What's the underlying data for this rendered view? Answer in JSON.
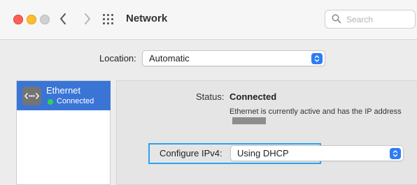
{
  "window": {
    "title": "Network"
  },
  "search": {
    "placeholder": "Search"
  },
  "location": {
    "label": "Location:",
    "value": "Automatic"
  },
  "sidebar": {
    "items": [
      {
        "name": "Ethernet",
        "status": "Connected",
        "status_color": "#2fd15a"
      }
    ]
  },
  "detail": {
    "status_label": "Status:",
    "status_value": "Connected",
    "description": "Ethernet is currently active and has the IP address",
    "configure_label": "Configure IPv4:",
    "configure_value": "Using DHCP"
  },
  "colors": {
    "accent": "#2d7cf6",
    "selection": "#3a75d6",
    "highlight_box": "#2aa3f2"
  }
}
